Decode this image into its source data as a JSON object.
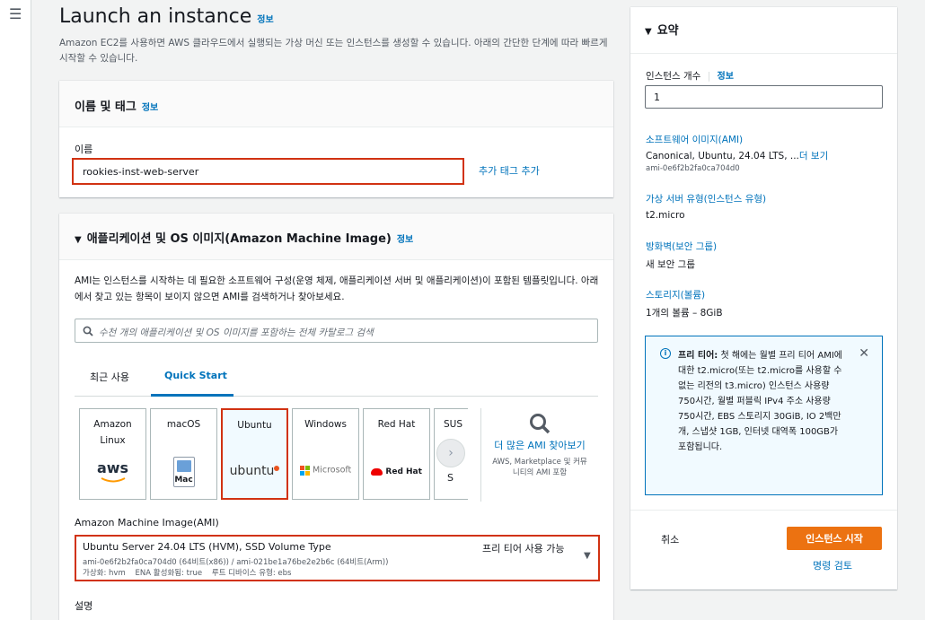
{
  "page": {
    "title": "Launch an instance",
    "title_info": "정보",
    "subtitle": "Amazon EC2를 사용하면 AWS 클라우드에서 실행되는 가상 머신 또는 인스턴스를 생성할 수 있습니다. 아래의 간단한 단계에 따라 빠르게 시작할 수 있습니다."
  },
  "name_tags": {
    "heading": "이름 및 태그",
    "info": "정보",
    "name_label": "이름",
    "name_value": "rookies-inst-web-server",
    "add_tags": "추가 태그 추가"
  },
  "ami": {
    "heading": "애플리케이션 및 OS 이미지(Amazon Machine Image)",
    "info": "정보",
    "description": "AMI는 인스턴스를 시작하는 데 필요한 소프트웨어 구성(운영 체제, 애플리케이션 서버 및 애플리케이션)이 포함된 템플릿입니다. 아래에서 찾고 있는 항목이 보이지 않으면 AMI를 검색하거나 찾아보세요.",
    "search_placeholder": "수천 개의 애플리케이션 및 OS 이미지를 포함하는 전체 카탈로그 검색",
    "tabs": [
      "최근 사용",
      "Quick Start"
    ],
    "cards": [
      {
        "name": "Amazon Linux",
        "logo": "aws"
      },
      {
        "name": "macOS",
        "logo": "Mac"
      },
      {
        "name": "Ubuntu",
        "logo": "ubuntu"
      },
      {
        "name": "Windows",
        "logo": "Microsoft"
      },
      {
        "name": "Red Hat",
        "logo": "Red Hat"
      },
      {
        "name": "SUS",
        "logo": "S"
      }
    ],
    "more_ami": "더 많은 AMI 찾아보기",
    "more_ami_sub": "AWS, Marketplace 및 커뮤니티의 AMI 포함",
    "ami_label": "Amazon Machine Image(AMI)",
    "selected_name": "Ubuntu Server 24.04 LTS (HVM), SSD Volume Type",
    "selected_ids": "ami-0e6f2b2fa0ca704d0 (64비트(x86)) / ami-021be1a76be2e2b6c (64비트(Arm))",
    "selected_meta": "가상화: hvm    ENA 활성화됨: true    루트 디바이스 유형: ebs",
    "free_tier": "프리 티어 사용 가능",
    "desc_label": "설명"
  },
  "summary": {
    "heading": "요약",
    "instance_count_label": "인스턴스 개수",
    "instance_count_info": "정보",
    "instance_count_value": "1",
    "software_label": "소프트웨어 이미지(AMI)",
    "software_value": "Canonical, Ubuntu, 24.04 LTS, ...",
    "software_more": "더 보기",
    "software_id": "ami-0e6f2b2fa0ca704d0",
    "instance_type_label": "가상 서버 유형(인스턴스 유형)",
    "instance_type_value": "t2.micro",
    "firewall_label": "방화벽(보안 그룹)",
    "firewall_value": "새 보안 그룹",
    "storage_label": "스토리지(볼륨)",
    "storage_value": "1개의 볼륨 – 8GiB",
    "free_tier_title": "프리 티어:",
    "free_tier_text": "첫 해에는 월별 프리 티어 AMI에 대한 t2.micro(또는 t2.micro를 사용할 수 없는 리전의 t3.micro) 인스턴스 사용량 750시간, 월별 퍼블릭 IPv4 주소 사용량 750시간, EBS 스토리지 30GiB, IO 2백만 개, 스냅샷 1GB, 인터넷 대역폭 100GB가 포함됩니다.",
    "cancel": "취소",
    "launch": "인스턴스 시작",
    "review": "명령 검토"
  },
  "colors": {
    "accent": "#0073bb",
    "primary_button": "#ec7211",
    "highlight_border": "#d13212",
    "info_box_bg": "#f1faff"
  }
}
